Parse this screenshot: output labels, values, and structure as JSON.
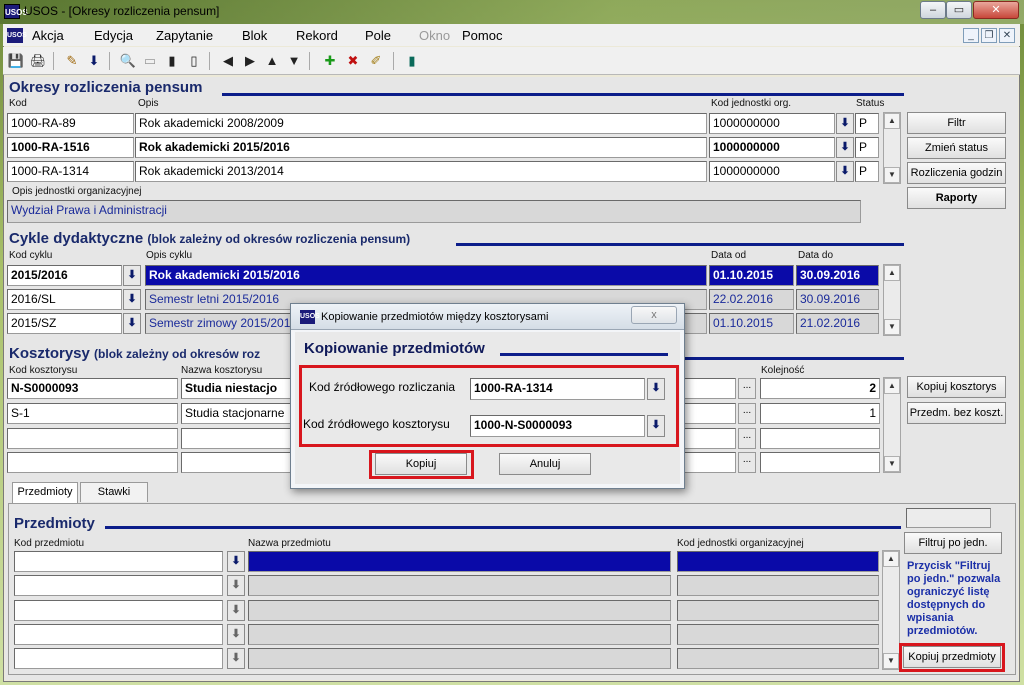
{
  "window": {
    "title": "USOS - [Okresy rozliczenia pensum]",
    "app_icon": "USOS",
    "caption_buttons": [
      "–",
      "▭",
      "✕"
    ]
  },
  "menu": {
    "items": [
      "Akcja",
      "Edycja",
      "Zapytanie",
      "Blok",
      "Rekord",
      "Pole",
      "Okno",
      "Pomoc"
    ],
    "disabled": [
      "Okno"
    ],
    "mdi_buttons": [
      "_",
      "❐",
      "✕"
    ]
  },
  "toolbar": {
    "icons": [
      "save-icon",
      "print-icon",
      "edit-icon",
      "download-icon",
      "search-icon",
      "clear-icon",
      "bars-icon",
      "bars2-icon",
      "prev-icon",
      "next-icon",
      "up-icon",
      "down-icon",
      "add-icon",
      "delete-icon",
      "erase-icon",
      "exit-icon"
    ],
    "glyphs": [
      "💾",
      "🖨",
      "✎",
      "⬇",
      "🔍",
      "▭",
      "▮",
      "▯",
      "◀",
      "▶",
      "▲",
      "▼",
      "✚",
      "✖",
      "✐",
      "▮"
    ]
  },
  "okresy": {
    "title": "Okresy rozliczenia pensum",
    "col_kod": "Kod",
    "col_opis": "Opis",
    "col_kod_jedn": "Kod jednostki org.",
    "col_status": "Status",
    "rows": [
      {
        "kod": "1000-RA-89",
        "opis": "Rok akademicki 2008/2009",
        "jedn": "1000000000",
        "status": "P"
      },
      {
        "kod": "1000-RA-1516",
        "opis": "Rok akademicki 2015/2016",
        "jedn": "1000000000",
        "status": "P"
      },
      {
        "kod": "1000-RA-1314",
        "opis": "Rok akademicki 2013/2014",
        "jedn": "1000000000",
        "status": "P"
      }
    ],
    "opis_jedn_label": "Opis jednostki organizacyjnej",
    "opis_jedn_value": "Wydział Prawa i Administracji",
    "buttons": {
      "filtr": "Filtr",
      "zmien_status": "Zmień status",
      "rozliczenia": "Rozliczenia godzin",
      "raporty": "Raporty"
    }
  },
  "cykle": {
    "title": "Cykle dydaktyczne",
    "subtitle": "(blok zależny od okresów rozliczenia pensum)",
    "col_kod": "Kod cyklu",
    "col_opis": "Opis cyklu",
    "col_od": "Data od",
    "col_do": "Data do",
    "rows": [
      {
        "kod": "2015/2016",
        "opis": "Rok akademicki 2015/2016",
        "od": "01.10.2015",
        "do": "30.09.2016"
      },
      {
        "kod": "2016/SL",
        "opis": "Semestr letni 2015/2016",
        "od": "22.02.2016",
        "do": "30.09.2016"
      },
      {
        "kod": "2015/SZ",
        "opis": "Semestr zimowy 2015/2016",
        "od": "01.10.2015",
        "do": "21.02.2016"
      }
    ]
  },
  "kosztorysy": {
    "title": "Kosztorysy",
    "subtitle": "(blok zależny od okresów roz",
    "col_kod": "Kod kosztorysu",
    "col_nazwa": "Nazwa kosztorysu",
    "col_kolejnosc": "Kolejność",
    "rows": [
      {
        "kod": "N-S0000093",
        "nazwa": "Studia niestacjo",
        "kolejnosc": "2"
      },
      {
        "kod": "S-1",
        "nazwa": "Studia stacjonarne",
        "kolejnosc": "1"
      }
    ],
    "buttons": {
      "kopiuj_kosztorys": "Kopiuj kosztorys",
      "przedm_bez": "Przedm. bez koszt."
    }
  },
  "tabs": [
    "Przedmioty",
    "Stawki"
  ],
  "przedmioty": {
    "title": "Przedmioty",
    "col_kod": "Kod przedmiotu",
    "col_nazwa": "Nazwa przedmiotu",
    "col_jedn": "Kod jednostki organizacyjnej",
    "filtruj_button": "Filtruj po jedn.",
    "note": "Przycisk \"Filtruj po jedn.\" pozwala ograniczyć listę dostępnych do wpisania przedmiotów.",
    "note_lines": [
      "Przycisk \"Filtruj",
      "po jedn.\" pozwala",
      "ograniczyć listę",
      "dostępnych do",
      "wpisania",
      "przedmiotów."
    ],
    "kopiuj_button": "Kopiuj przedmioty"
  },
  "dialog": {
    "title": "Kopiowanie przedmiotów między kosztorysami",
    "heading": "Kopiowanie  przedmiotów",
    "field1_label": "Kod źródłowego rozliczania",
    "field1_value": "1000-RA-1314",
    "field2_label": "Kod źródłowego kosztorysu",
    "field2_value": "1000-N-S0000093",
    "ok_button": "Kopiuj",
    "cancel_button": "Anuluj",
    "close": "x"
  },
  "colors": {
    "accent_line": "#0c1d8a",
    "selection": "#0a0aa8",
    "highlight_red": "#d8161d"
  }
}
